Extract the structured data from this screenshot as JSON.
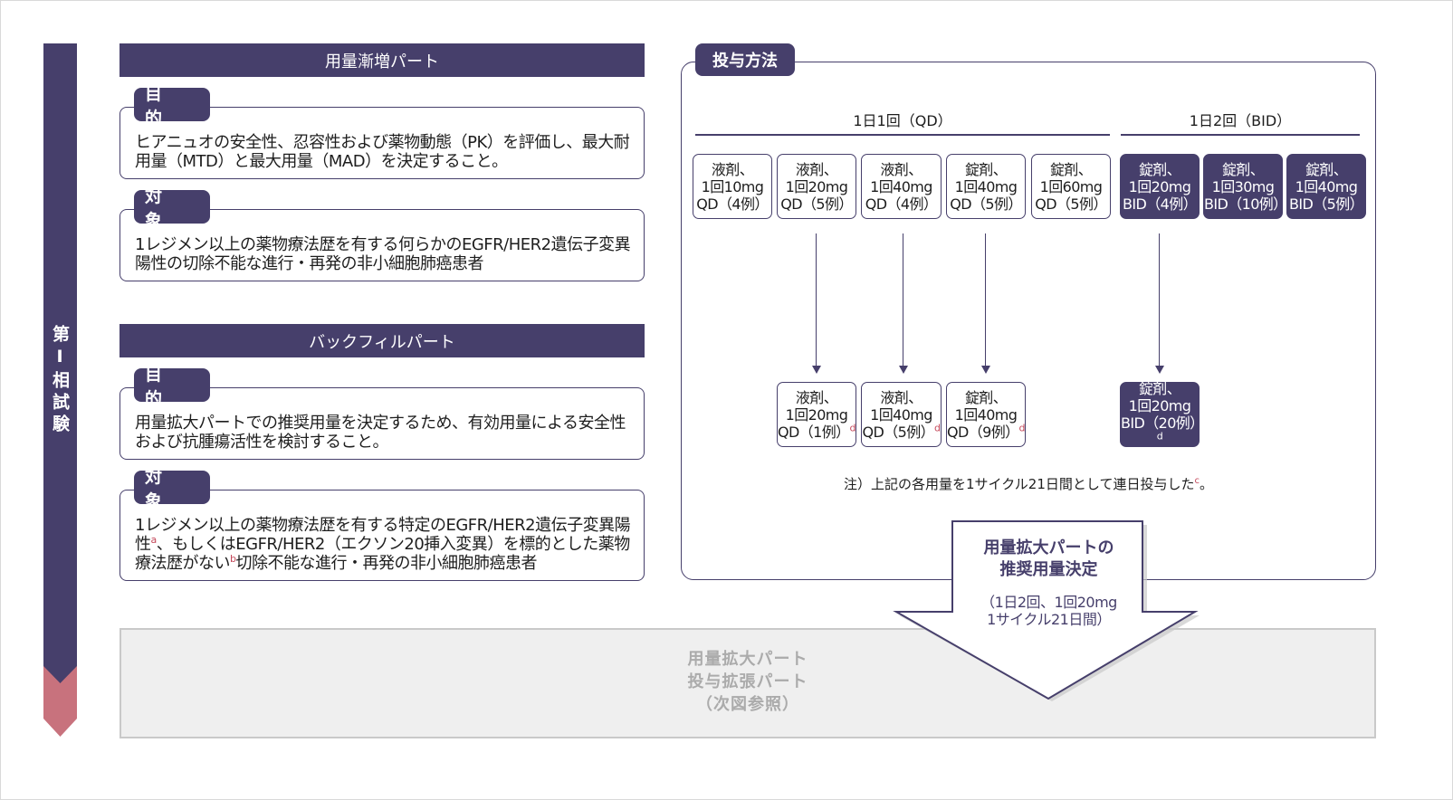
{
  "phase_label": "第Ⅰ相試験",
  "dose_escalation": {
    "header": "用量漸増パート",
    "purpose_label": "目 的",
    "purpose_text": "ヒアニュオの安全性、忍容性および薬物動態（PK）を評価し、最大耐用量（MTD）と最大用量（MAD）を決定すること。",
    "subject_label": "対 象",
    "subject_text": "1レジメン以上の薬物療法歴を有する何らかのEGFR/HER2遺伝子変異陽性の切除不能な進行・再発の非小細胞肺癌患者"
  },
  "backfill": {
    "header": "バックフィルパート",
    "purpose_label": "目 的",
    "purpose_text": "用量拡大パートでの推奨用量を決定するため、有効用量による安全性および抗腫瘍活性を検討すること。",
    "subject_label": "対 象",
    "subject_text_1": "1レジメン以上の薬物療法歴を有する特定のEGFR/HER2遺伝子変異陽性",
    "footnote_a": "a",
    "subject_text_2": "、もしくはEGFR/HER2（エクソン20挿入変異）を標的とした薬物療法歴がない",
    "footnote_b": "b",
    "subject_text_3": "切除不能な進行・再発の非小細胞肺癌患者"
  },
  "dosing": {
    "tab_label": "投与方法",
    "qd_title": "1日1回（QD）",
    "bid_title": "1日2回（BID）",
    "escalation_doses": [
      {
        "l1": "液剤、",
        "l2": "1回10mg",
        "l3": "QD（4例）"
      },
      {
        "l1": "液剤、",
        "l2": "1回20mg",
        "l3": "QD（5例）"
      },
      {
        "l1": "液剤、",
        "l2": "1回40mg",
        "l3": "QD（4例）"
      },
      {
        "l1": "錠剤、",
        "l2": "1回40mg",
        "l3": "QD（5例）"
      },
      {
        "l1": "錠剤、",
        "l2": "1回60mg",
        "l3": "QD（5例）"
      },
      {
        "l1": "錠剤、",
        "l2": "1回20mg",
        "l3": "BID（4例）"
      },
      {
        "l1": "錠剤、",
        "l2": "1回30mg",
        "l3": "BID（10例）"
      },
      {
        "l1": "錠剤、",
        "l2": "1回40mg",
        "l3": "BID（5例）"
      }
    ],
    "backfill_doses": [
      {
        "l1": "液剤、",
        "l2": "1回20mg",
        "l3": "QD（1例）",
        "fn": "d"
      },
      {
        "l1": "液剤、",
        "l2": "1回40mg",
        "l3": "QD（5例）",
        "fn": "d"
      },
      {
        "l1": "錠剤、",
        "l2": "1回40mg",
        "l3": "QD（9例）",
        "fn": "d"
      },
      {
        "l1": "錠剤、",
        "l2": "1回20mg",
        "l3": "BID（20例）",
        "fn": "d"
      }
    ],
    "note_text": "注）上記の各用量を1サイクル21日間として連日投与した",
    "note_fn": "c",
    "note_end": "。"
  },
  "decision": {
    "title_1": "用量拡大パートの",
    "title_2": "推奨用量決定",
    "sub_1": "（1日2回、1回20mg",
    "sub_2": "1サイクル21日間）"
  },
  "expansion": {
    "line1": "用量拡大パート",
    "line2": "投与拡張パート",
    "line3": "（次図参照）"
  },
  "colors": {
    "primary": "#463f6b",
    "accent": "#c4485a",
    "gray_box": "#efefef",
    "gray_text": "#ababab"
  }
}
